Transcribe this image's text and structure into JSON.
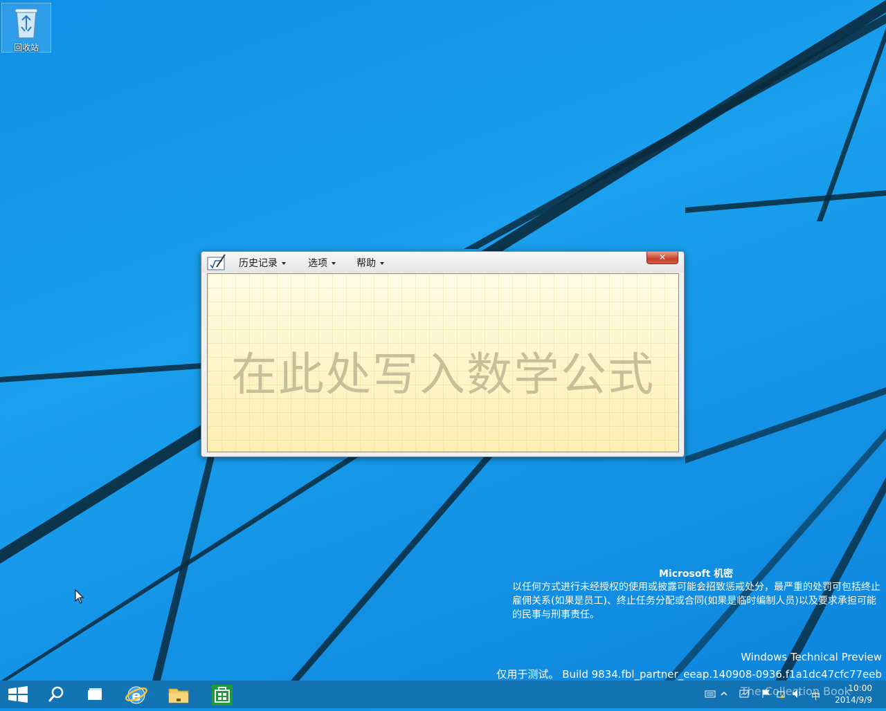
{
  "desktop": {
    "recycle_bin_label": "回收站",
    "watermark": {
      "title": "Microsoft 机密",
      "body": "以任何方式进行未经授权的使用或披露可能会招致惩戒处分，最严重的处罚可包括终止雇佣关系(如果是员工)、终止任务分配或合同(如果是临时编制人员)以及要求承担可能的民事与刑事责任。",
      "product": "Windows Technical Preview",
      "build": "仅用于测试。 Build 9834.fbl_partner_eeap.140908-0936.f1a1dc47cfc77eeb"
    }
  },
  "window": {
    "menus": [
      {
        "label": "历史记录"
      },
      {
        "label": "选项"
      },
      {
        "label": "帮助"
      }
    ],
    "close_label": "✕",
    "placeholder": "在此处写入数学公式"
  },
  "taskbar": {
    "items": [
      "start-icon",
      "search-icon",
      "task-view-icon",
      "internet-explorer-icon",
      "file-explorer-icon",
      "store-icon"
    ],
    "tray": {
      "ime": "中",
      "time": "10:00",
      "date": "2014/9/9",
      "watermark_text": "The Collection Book"
    }
  },
  "colors": {
    "accent": "#1aa0ee",
    "writing_area": "#fdf4cc",
    "placeholder_text": "#c7bf98"
  }
}
